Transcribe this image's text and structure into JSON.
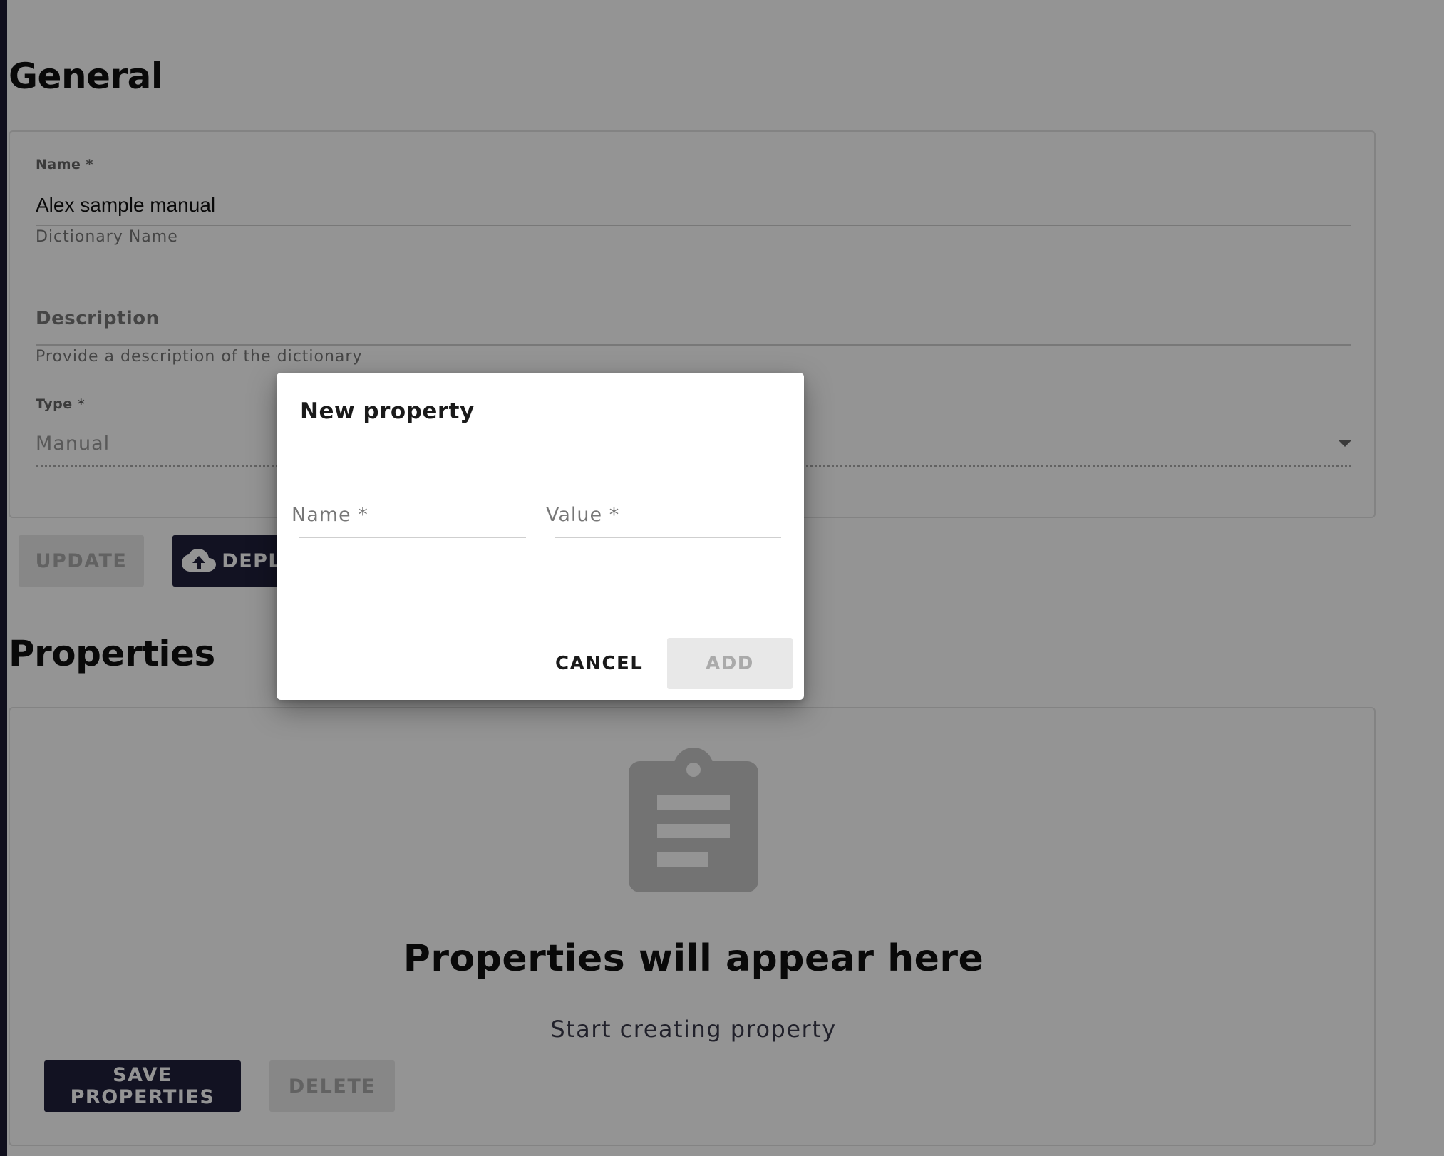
{
  "general": {
    "title": "General",
    "name_label": "Name *",
    "name_value": "Alex sample manual",
    "name_helper": "Dictionary Name",
    "description_label": "Description",
    "description_helper": "Provide a description of the dictionary",
    "type_label": "Type *",
    "type_value": "Manual"
  },
  "actions": {
    "update_label": "UPDATE",
    "deploy_label": "DEPLOY"
  },
  "properties": {
    "title": "Properties",
    "empty_title": "Properties will appear here",
    "empty_subtitle": "Start creating property",
    "save_label": "SAVE PROPERTIES",
    "delete_label": "DELETE"
  },
  "dialog": {
    "title": "New property",
    "name_label": "Name *",
    "value_label": "Value *",
    "cancel_label": "CANCEL",
    "add_label": "ADD"
  },
  "icons": {
    "deploy": "cloud-upload-icon",
    "empty_state": "clipboard-icon",
    "type_select": "chevron-down-icon"
  },
  "colors": {
    "primary_dark": "#1f1f3c",
    "disabled_bg": "#e8e8e8",
    "disabled_text": "#aaaaaa",
    "left_rail": "#1c1b33"
  }
}
